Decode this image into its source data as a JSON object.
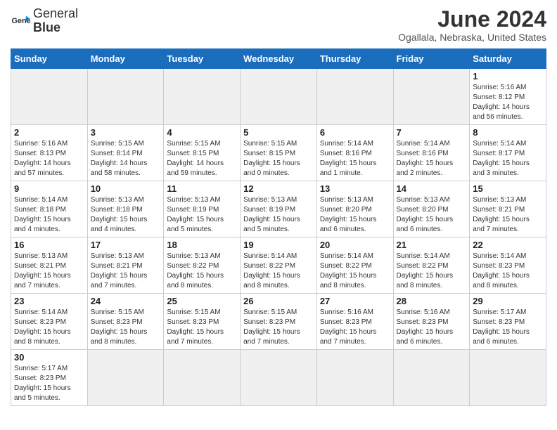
{
  "header": {
    "logo_general": "General",
    "logo_blue": "Blue",
    "month_year": "June 2024",
    "location": "Ogallala, Nebraska, United States"
  },
  "weekdays": [
    "Sunday",
    "Monday",
    "Tuesday",
    "Wednesday",
    "Thursday",
    "Friday",
    "Saturday"
  ],
  "weeks": [
    [
      {
        "day": "",
        "empty": true
      },
      {
        "day": "",
        "empty": true
      },
      {
        "day": "",
        "empty": true
      },
      {
        "day": "",
        "empty": true
      },
      {
        "day": "",
        "empty": true
      },
      {
        "day": "",
        "empty": true
      },
      {
        "day": "1",
        "sunrise": "5:16 AM",
        "sunset": "8:12 PM",
        "daylight": "14 hours and 56 minutes."
      }
    ],
    [
      {
        "day": "2",
        "sunrise": "5:16 AM",
        "sunset": "8:13 PM",
        "daylight": "14 hours and 57 minutes."
      },
      {
        "day": "3",
        "sunrise": "5:15 AM",
        "sunset": "8:14 PM",
        "daylight": "14 hours and 58 minutes."
      },
      {
        "day": "4",
        "sunrise": "5:15 AM",
        "sunset": "8:15 PM",
        "daylight": "14 hours and 59 minutes."
      },
      {
        "day": "5",
        "sunrise": "5:15 AM",
        "sunset": "8:15 PM",
        "daylight": "15 hours and 0 minutes."
      },
      {
        "day": "6",
        "sunrise": "5:14 AM",
        "sunset": "8:16 PM",
        "daylight": "15 hours and 1 minute."
      },
      {
        "day": "7",
        "sunrise": "5:14 AM",
        "sunset": "8:16 PM",
        "daylight": "15 hours and 2 minutes."
      },
      {
        "day": "8",
        "sunrise": "5:14 AM",
        "sunset": "8:17 PM",
        "daylight": "15 hours and 3 minutes."
      }
    ],
    [
      {
        "day": "9",
        "sunrise": "5:14 AM",
        "sunset": "8:18 PM",
        "daylight": "15 hours and 4 minutes."
      },
      {
        "day": "10",
        "sunrise": "5:13 AM",
        "sunset": "8:18 PM",
        "daylight": "15 hours and 4 minutes."
      },
      {
        "day": "11",
        "sunrise": "5:13 AM",
        "sunset": "8:19 PM",
        "daylight": "15 hours and 5 minutes."
      },
      {
        "day": "12",
        "sunrise": "5:13 AM",
        "sunset": "8:19 PM",
        "daylight": "15 hours and 5 minutes."
      },
      {
        "day": "13",
        "sunrise": "5:13 AM",
        "sunset": "8:20 PM",
        "daylight": "15 hours and 6 minutes."
      },
      {
        "day": "14",
        "sunrise": "5:13 AM",
        "sunset": "8:20 PM",
        "daylight": "15 hours and 6 minutes."
      },
      {
        "day": "15",
        "sunrise": "5:13 AM",
        "sunset": "8:21 PM",
        "daylight": "15 hours and 7 minutes."
      }
    ],
    [
      {
        "day": "16",
        "sunrise": "5:13 AM",
        "sunset": "8:21 PM",
        "daylight": "15 hours and 7 minutes."
      },
      {
        "day": "17",
        "sunrise": "5:13 AM",
        "sunset": "8:21 PM",
        "daylight": "15 hours and 7 minutes."
      },
      {
        "day": "18",
        "sunrise": "5:13 AM",
        "sunset": "8:22 PM",
        "daylight": "15 hours and 8 minutes."
      },
      {
        "day": "19",
        "sunrise": "5:14 AM",
        "sunset": "8:22 PM",
        "daylight": "15 hours and 8 minutes."
      },
      {
        "day": "20",
        "sunrise": "5:14 AM",
        "sunset": "8:22 PM",
        "daylight": "15 hours and 8 minutes."
      },
      {
        "day": "21",
        "sunrise": "5:14 AM",
        "sunset": "8:22 PM",
        "daylight": "15 hours and 8 minutes."
      },
      {
        "day": "22",
        "sunrise": "5:14 AM",
        "sunset": "8:23 PM",
        "daylight": "15 hours and 8 minutes."
      }
    ],
    [
      {
        "day": "23",
        "sunrise": "5:14 AM",
        "sunset": "8:23 PM",
        "daylight": "15 hours and 8 minutes."
      },
      {
        "day": "24",
        "sunrise": "5:15 AM",
        "sunset": "8:23 PM",
        "daylight": "15 hours and 8 minutes."
      },
      {
        "day": "25",
        "sunrise": "5:15 AM",
        "sunset": "8:23 PM",
        "daylight": "15 hours and 7 minutes."
      },
      {
        "day": "26",
        "sunrise": "5:15 AM",
        "sunset": "8:23 PM",
        "daylight": "15 hours and 7 minutes."
      },
      {
        "day": "27",
        "sunrise": "5:16 AM",
        "sunset": "8:23 PM",
        "daylight": "15 hours and 7 minutes."
      },
      {
        "day": "28",
        "sunrise": "5:16 AM",
        "sunset": "8:23 PM",
        "daylight": "15 hours and 6 minutes."
      },
      {
        "day": "29",
        "sunrise": "5:17 AM",
        "sunset": "8:23 PM",
        "daylight": "15 hours and 6 minutes."
      }
    ],
    [
      {
        "day": "30",
        "sunrise": "5:17 AM",
        "sunset": "8:23 PM",
        "daylight": "15 hours and 5 minutes."
      },
      {
        "day": "",
        "empty": true
      },
      {
        "day": "",
        "empty": true
      },
      {
        "day": "",
        "empty": true
      },
      {
        "day": "",
        "empty": true
      },
      {
        "day": "",
        "empty": true
      },
      {
        "day": "",
        "empty": true
      }
    ]
  ]
}
